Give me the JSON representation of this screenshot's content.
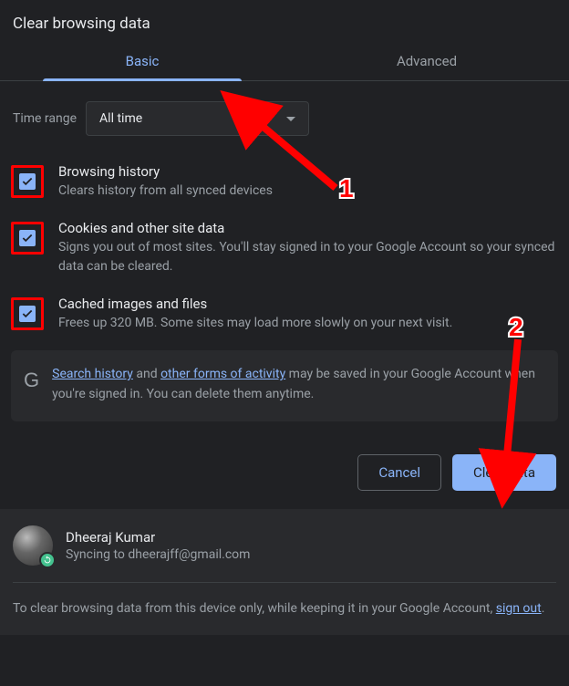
{
  "title": "Clear browsing data",
  "tabs": {
    "basic": "Basic",
    "advanced": "Advanced"
  },
  "time_range_label": "Time range",
  "time_range_value": "All time",
  "options": [
    {
      "title": "Browsing history",
      "desc": "Clears history from all synced devices"
    },
    {
      "title": "Cookies and other site data",
      "desc": "Signs you out of most sites. You'll stay signed in to your Google Account so your synced data can be cleared."
    },
    {
      "title": "Cached images and files",
      "desc": "Frees up 320 MB. Some sites may load more slowly on your next visit."
    }
  ],
  "notice": {
    "link1": "Search history",
    "mid1": " and ",
    "link2": "other forms of activity",
    "tail": " may be saved in your Google Account when you're signed in. You can delete them anytime."
  },
  "buttons": {
    "cancel": "Cancel",
    "clear": "Clear data"
  },
  "user": {
    "name": "Dheeraj Kumar",
    "sync": "Syncing to dheerajff@gmail.com"
  },
  "footer_note": {
    "pre": "To clear browsing data from this device only, while keeping it in your Google Account, ",
    "link": "sign out",
    "post": "."
  },
  "annotations": {
    "label1": "1",
    "label2": "2"
  }
}
